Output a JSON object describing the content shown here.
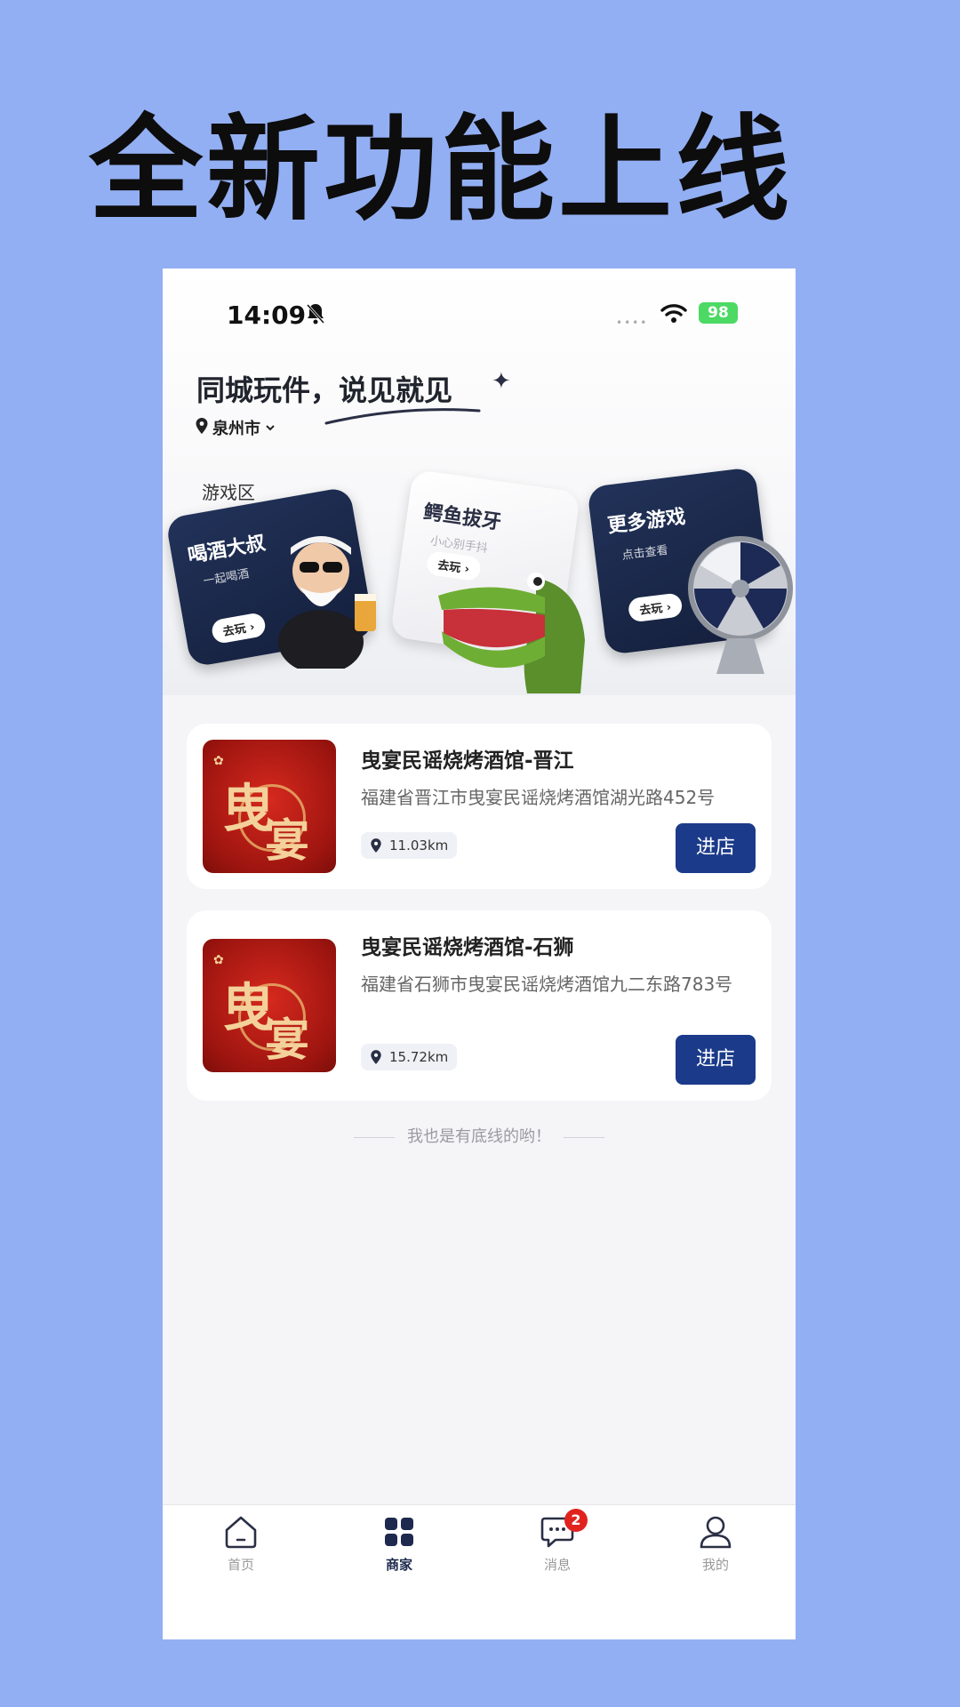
{
  "headline": "全新功能上线",
  "status_bar": {
    "time": "14:09",
    "battery": "98"
  },
  "header": {
    "slogan": "同城玩件，说见就见",
    "city": "泉州市"
  },
  "game_zone": {
    "label": "游戏区",
    "cards": [
      {
        "title": "喝酒大叔",
        "subtitle": "一起喝酒",
        "button": "去玩"
      },
      {
        "title": "鳄鱼拔牙",
        "subtitle": "小心别手抖",
        "button": "去玩"
      },
      {
        "title": "更多游戏",
        "subtitle": "点击查看",
        "button": "去玩"
      }
    ]
  },
  "stores": [
    {
      "name": "曳宴民谣烧烤酒馆-晋江",
      "address": "福建省晋江市曳宴民谣烧烤酒馆湖光路452号",
      "distance": "11.03km",
      "button": "进店",
      "logo_text": [
        "曳",
        "宴"
      ]
    },
    {
      "name": "曳宴民谣烧烤酒馆-石狮",
      "address": "福建省石狮市曳宴民谣烧烤酒馆九二东路783号",
      "distance": "15.72km",
      "button": "进店",
      "logo_text": [
        "曳",
        "宴"
      ]
    }
  ],
  "footer_note": "我也是有底线的哟！",
  "tabs": [
    {
      "label": "首页",
      "icon": "home-icon"
    },
    {
      "label": "商家",
      "icon": "grid-icon",
      "active": true
    },
    {
      "label": "消息",
      "icon": "message-icon",
      "badge": "2"
    },
    {
      "label": "我的",
      "icon": "user-icon"
    }
  ],
  "colors": {
    "page_bg": "#93aff3",
    "accent": "#1b3a8a",
    "badge": "#e0231e"
  }
}
